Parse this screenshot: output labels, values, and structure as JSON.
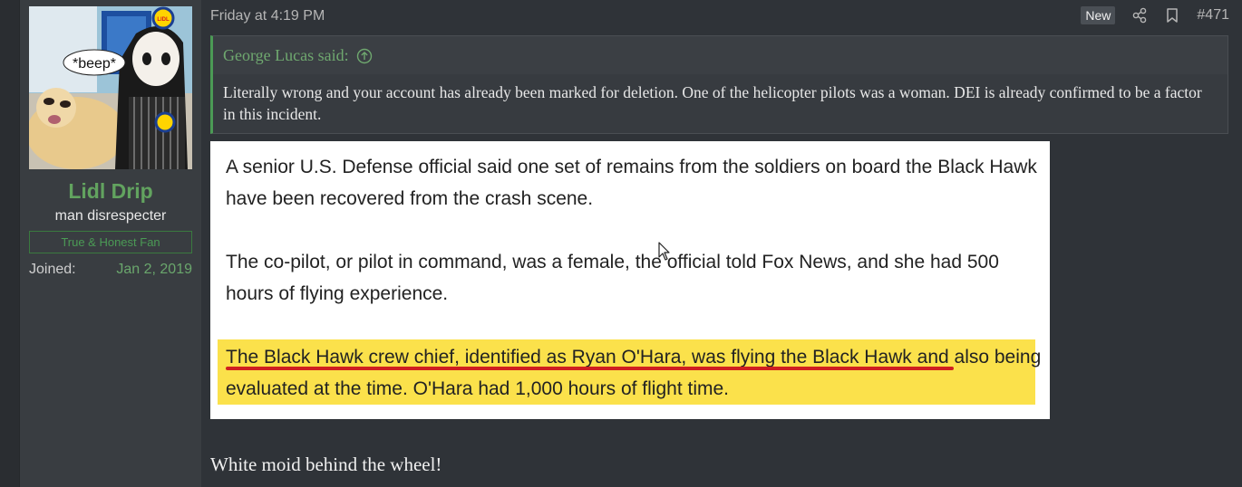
{
  "user": {
    "avatar_caption": "*beep*",
    "avatar_logo_text": "LIDL",
    "username": "Lidl Drip",
    "user_title": "man disrespecter",
    "banner": "True & Honest Fan",
    "joined_label": "Joined:",
    "joined_value": "Jan 2, 2019"
  },
  "post": {
    "date": "Friday at 4:19 PM",
    "new_badge": "New",
    "post_number": "#471",
    "icons": [
      "share-icon",
      "bookmark-icon"
    ],
    "quote": {
      "author": "George Lucas said:",
      "author_icon": "arrow-up-circle-icon",
      "body": "Literally wrong and your account has already been marked for deletion. One of the helicopter pilots was a woman. DEI is already confirmed to be a factor in this incident."
    },
    "embedded_image": {
      "paragraph_1": "A senior U.S. Defense official said one set of remains from the soldiers on board the Black Hawk have been recovered from the crash scene.",
      "paragraph_2": "The co-pilot, or pilot in command, was a female, the official told Fox News, and she had 500 hours of flying experience.",
      "paragraph_3": "The Black Hawk crew chief, identified as Ryan O'Hara, was flying the Black Hawk and also being evaluated at the time. O'Hara had 1,000 hours of flight time."
    },
    "reply_text": "White moid behind the wheel!"
  },
  "colors": {
    "accent_green": "#62a35f",
    "quote_border": "#4b9a55",
    "highlight": "#fbe14b",
    "underline_red": "#d01f1f"
  }
}
